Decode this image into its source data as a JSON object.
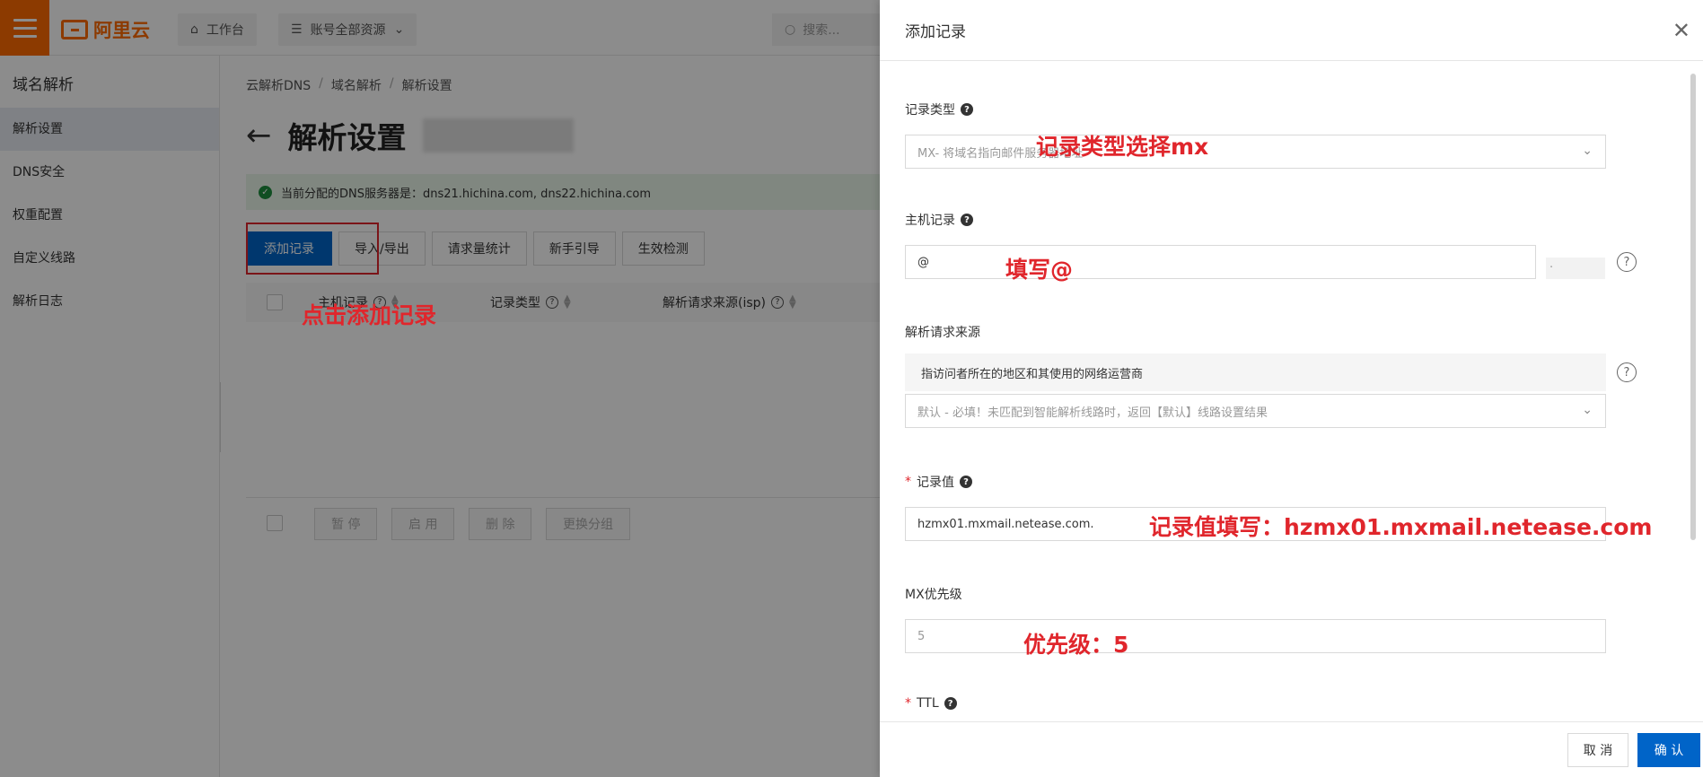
{
  "topbar": {
    "logo_text": "阿里云",
    "workbench_label": "工作台",
    "resources_label": "账号全部资源",
    "search_placeholder": "搜索..."
  },
  "sidebar": {
    "title": "域名解析",
    "items": [
      {
        "label": "解析设置"
      },
      {
        "label": "DNS安全"
      },
      {
        "label": "权重配置"
      },
      {
        "label": "自定义线路"
      },
      {
        "label": "解析日志"
      }
    ]
  },
  "main": {
    "breadcrumb": [
      "云解析DNS",
      "域名解析",
      "解析设置"
    ],
    "page_title": "解析设置",
    "dns_notice": "当前分配的DNS服务器是：dns21.hichina.com, dns22.hichina.com",
    "toolbar": {
      "add_record": "添加记录",
      "import_export": "导入/导出",
      "request_stats": "请求量统计",
      "guide": "新手引导",
      "check": "生效检测"
    },
    "table_headers": {
      "host": "主机记录",
      "type": "记录类型",
      "source": "解析请求来源(isp)"
    },
    "bulk_actions": {
      "pause": "暂 停",
      "enable": "启 用",
      "delete": "删 除",
      "group": "更换分组"
    }
  },
  "drawer": {
    "title": "添加记录",
    "record_type": {
      "label": "记录类型",
      "value": "MX- 将域名指向邮件服务器地址"
    },
    "host": {
      "label": "主机记录",
      "value": "@",
      "suffix": "."
    },
    "source": {
      "label": "解析请求来源",
      "info": "指访问者所在的地区和其使用的网络运营商",
      "value": "默认 - 必填！未匹配到智能解析线路时，返回【默认】线路设置结果"
    },
    "record_value": {
      "required_mark": "*",
      "label": "记录值",
      "value": "hzmx01.mxmail.netease.com."
    },
    "mx_priority": {
      "label": "MX优先级",
      "value": "5"
    },
    "ttl": {
      "required_mark": "*",
      "label": "TTL"
    },
    "cancel": "取 消",
    "confirm": "确 认"
  },
  "annotations": {
    "click_add": "点击添加记录",
    "type_mx": "记录类型选择mx",
    "host_at": "填写@",
    "value_hint": "记录值填写：hzmx01.mxmail.netease.com",
    "priority_hint": "优先级：5"
  },
  "colors": {
    "accent": "#ff6a00",
    "primary": "#0064c8",
    "annotation": "#e0262c"
  }
}
